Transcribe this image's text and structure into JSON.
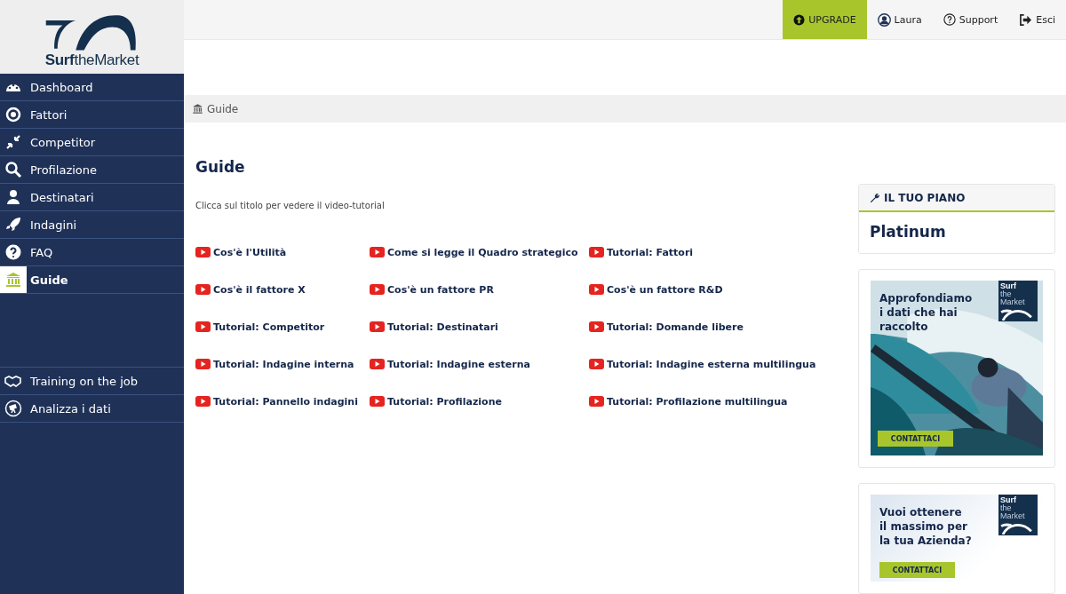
{
  "logo": {
    "text": "**Surf**theMarket"
  },
  "sidebar": {
    "items": [
      {
        "label": "Dashboard",
        "selected": false
      },
      {
        "label": "Fattori",
        "selected": false
      },
      {
        "label": "Competitor",
        "selected": false
      },
      {
        "label": "Profilazione",
        "selected": false
      },
      {
        "label": "Destinatari",
        "selected": false
      },
      {
        "label": "Indagini",
        "selected": false
      },
      {
        "label": "FAQ",
        "selected": false
      },
      {
        "label": "Guide",
        "selected": true
      }
    ],
    "bottom_items": [
      {
        "label": "Training on the job",
        "selected": false
      },
      {
        "label": "Analizza i dati",
        "selected": false
      }
    ]
  },
  "topbar": {
    "upgrade": "UPGRADE",
    "user": "Laura",
    "support": "Support",
    "logout": "Esci"
  },
  "breadcrumb": "Guide",
  "page": {
    "title": "Guide",
    "subtitle": "Clicca sul titolo per vedere il video-tutorial",
    "videos": [
      "Cos'è l'Utilità",
      "Come si legge il Quadro strategico",
      "Tutorial: Fattori",
      "Cos'è il fattore X",
      "Cos'è un fattore PR",
      "Cos'è un fattore R&D",
      "Tutorial: Competitor",
      "Tutorial: Destinatari",
      "Tutorial: Domande libere",
      "Tutorial: Indagine interna",
      "Tutorial: Indagine esterna",
      "Tutorial: Indagine esterna multilingua",
      "Tutorial: Pannello indagini",
      "Tutorial: Profilazione",
      "Tutorial: Profilazione multilingua"
    ]
  },
  "plan": {
    "heading": "IL TUO PIANO",
    "name": "Platinum"
  },
  "ads": [
    {
      "kind": "picture",
      "headline": [
        "Approfondiamo",
        "i dati che hai",
        "raccolto"
      ],
      "logo": [
        "Surf",
        "the",
        "Market"
      ],
      "button": "CONTATTACI"
    },
    {
      "kind": "plain",
      "headline": [
        "Vuoi ottenere",
        "il massimo per",
        "la tua Azienda?"
      ],
      "logo": [
        "Surf",
        "the",
        "Market"
      ],
      "button": "CONTATTACI"
    }
  ]
}
